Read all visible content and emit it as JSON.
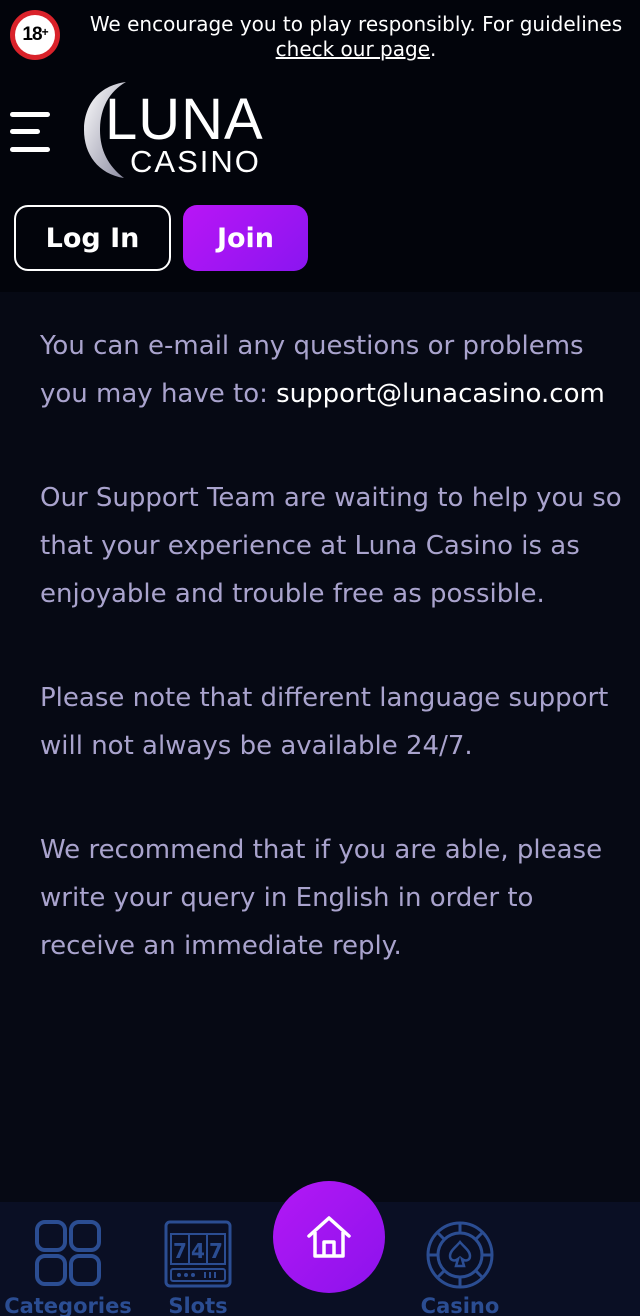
{
  "banner": {
    "age_badge": "18",
    "age_plus": "+",
    "text": "We encourage you to play responsibly. For guidelines",
    "link_text": "check our page",
    "link_suffix": "."
  },
  "header": {
    "logo_main": "LUNA",
    "logo_sub": "CASINO",
    "login_label": "Log In",
    "join_label": "Join"
  },
  "content": {
    "p1_text": "You can e-mail any questions or problems you may have to: ",
    "p1_email": "support@lunacasino.com",
    "p2": "Our Support Team are waiting to help you so that your experience at Luna Casino is as enjoyable and trouble free as possible.",
    "p3": "Please note that different language support will not always be available 24/7.",
    "p4": "We recommend that if you are able, please write your query in English in order to receive an immediate reply."
  },
  "bottom_nav": {
    "items": [
      {
        "label": "Categories",
        "icon": "grid-icon"
      },
      {
        "label": "Slots",
        "icon": "slot-machine-icon"
      },
      {
        "label": "Home",
        "icon": "home-icon"
      },
      {
        "label": "Casino",
        "icon": "casino-chip-icon"
      }
    ]
  },
  "colors": {
    "accent": "#9b17f3",
    "background": "#060914",
    "header_bg": "#02040b",
    "text": "#a9a3cd",
    "nav_icon": "#2b4d92"
  }
}
